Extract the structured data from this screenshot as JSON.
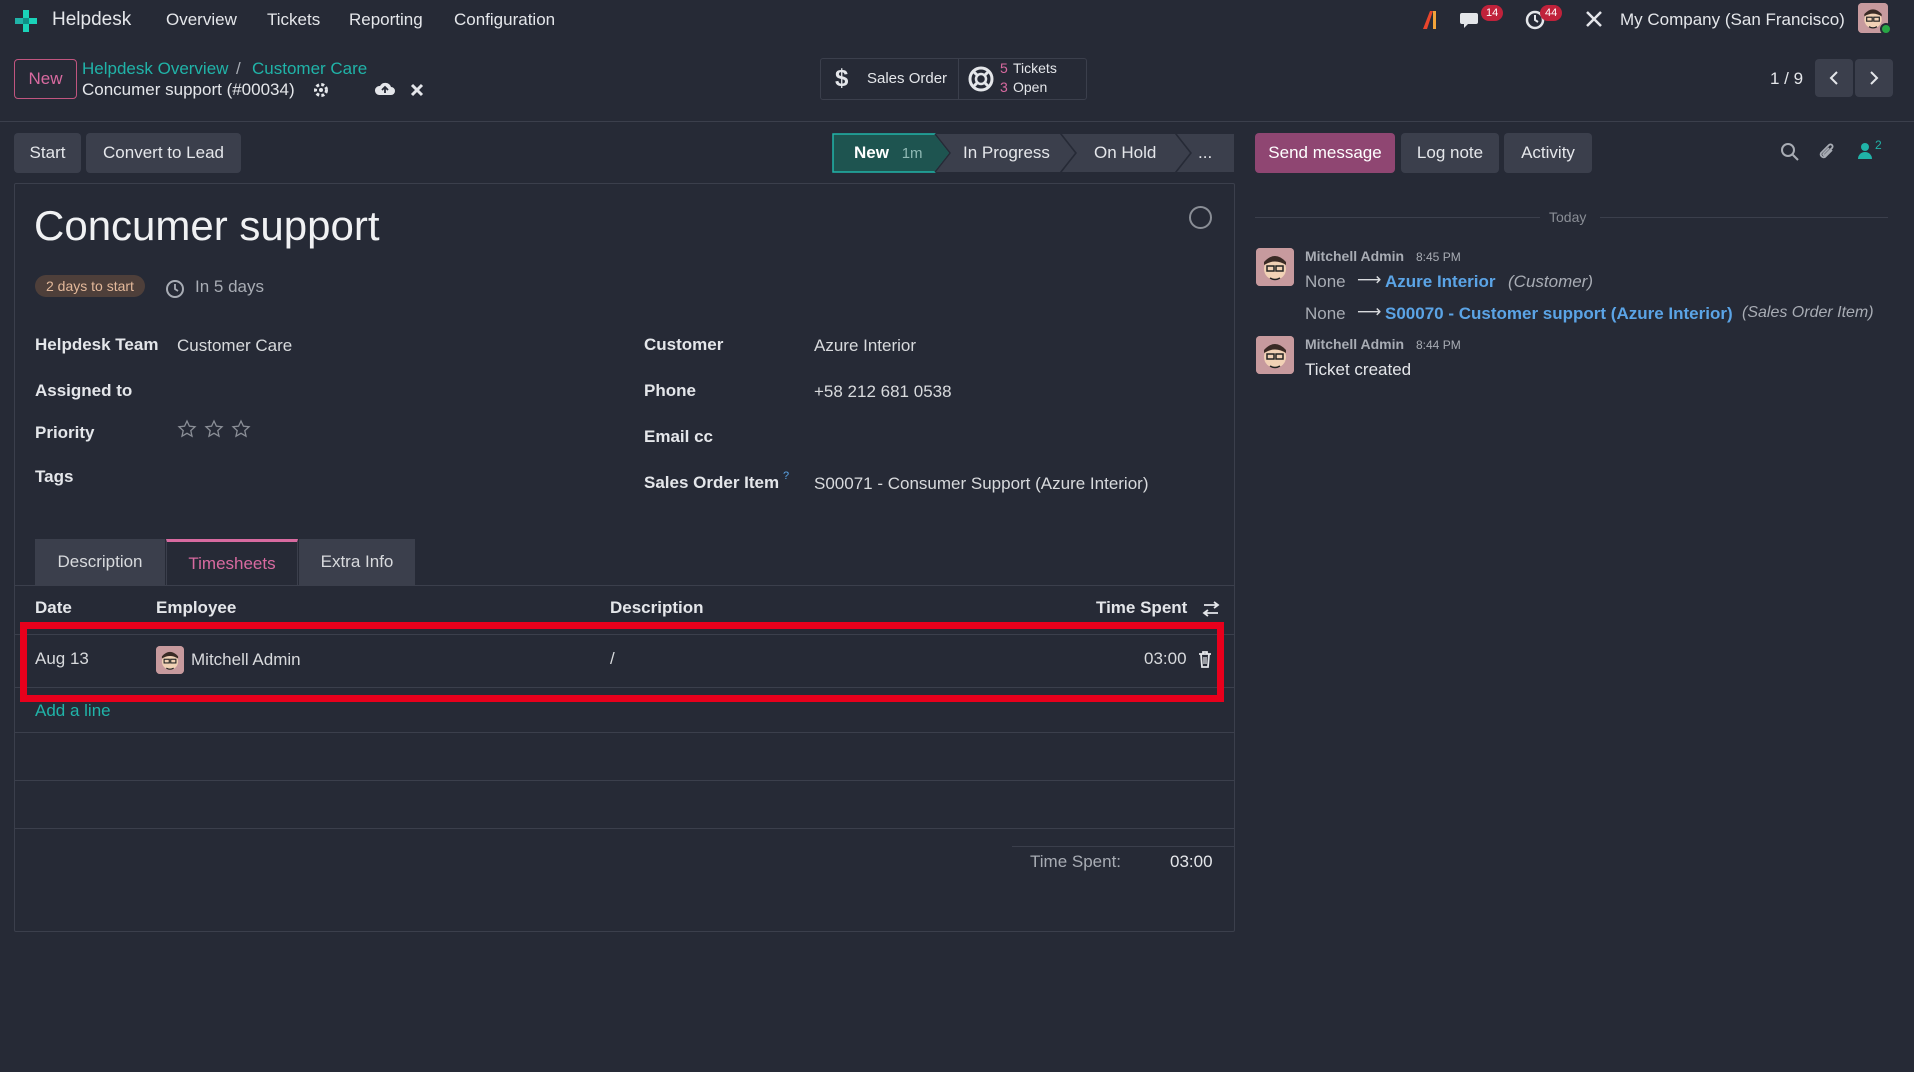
{
  "navbar": {
    "app_name": "Helpdesk",
    "menu": [
      "Overview",
      "Tickets",
      "Reporting",
      "Configuration"
    ],
    "messages_count": "14",
    "activities_count": "44",
    "company": "My Company (San Francisco)"
  },
  "control": {
    "new_label": "New",
    "breadcrumb": [
      "Helpdesk Overview",
      "Customer Care"
    ],
    "record_title": "Concumer support (#00034)",
    "sales_order_label": "Sales Order",
    "tickets_count": "5",
    "tickets_label": "Tickets",
    "open_count": "3",
    "open_label": "Open",
    "pager": "1 / 9"
  },
  "actions": {
    "start": "Start",
    "convert": "Convert to Lead"
  },
  "stages": {
    "new": "New",
    "new_duration": "1m",
    "in_progress": "In Progress",
    "on_hold": "On Hold",
    "more": "..."
  },
  "chatter_buttons": {
    "send": "Send message",
    "log": "Log note",
    "activity": "Activity",
    "followers": "2"
  },
  "ticket": {
    "title": "Concumer support",
    "days_badge": "2 days to start",
    "deadline": "In 5 days",
    "fields": {
      "team_label": "Helpdesk Team",
      "team_value": "Customer Care",
      "assigned_label": "Assigned to",
      "priority_label": "Priority",
      "tags_label": "Tags",
      "customer_label": "Customer",
      "customer_value": "Azure Interior",
      "phone_label": "Phone",
      "phone_value": "+58 212 681 0538",
      "email_cc_label": "Email cc",
      "so_item_label": "Sales Order Item",
      "so_item_help": "?",
      "so_item_value": "S00071 - Consumer Support (Azure Interior)"
    },
    "priority_stars": 0
  },
  "tabs": [
    "Description",
    "Timesheets",
    "Extra Info"
  ],
  "active_tab": "Timesheets",
  "timesheets": {
    "columns": [
      "Date",
      "Employee",
      "Description",
      "Time Spent"
    ],
    "rows": [
      {
        "date": "Aug 13",
        "employee": "Mitchell Admin",
        "description": "/",
        "time": "03:00"
      }
    ],
    "add_line": "Add a line",
    "total_label": "Time Spent:",
    "total_value": "03:00"
  },
  "chatter": {
    "separator": "Today",
    "messages": [
      {
        "author": "Mitchell Admin",
        "time": "8:45 PM",
        "changes": [
          {
            "old": "None",
            "arrow": "⟶",
            "new": "Azure Interior",
            "field": "(Customer)"
          },
          {
            "old": "None",
            "arrow": "⟶",
            "new": "S00070 - Customer support (Azure Interior)",
            "field": "(Sales Order Item)"
          }
        ]
      },
      {
        "author": "Mitchell Admin",
        "time": "8:44 PM",
        "body": "Ticket created"
      }
    ]
  },
  "colors": {
    "background": "#262a36",
    "accent_teal": "#20b3a8",
    "primary_button": "#8f4672",
    "highlight_box": "#e8001c",
    "link_blue": "#5ba4e6"
  }
}
